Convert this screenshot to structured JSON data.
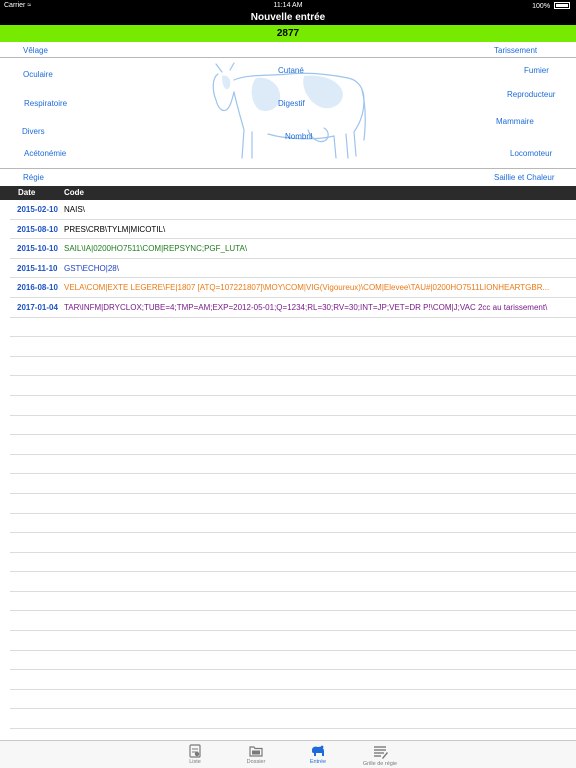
{
  "status_bar": {
    "carrier": "Carrier",
    "wifi_icon": "wifi-icon",
    "time": "11:14 AM",
    "battery": "100%"
  },
  "nav": {
    "title": "Nouvelle entrée"
  },
  "animal": {
    "number": "2877",
    "highlight_color": "#76ea00"
  },
  "categories": {
    "velage": "Vêlage",
    "tarissement": "Tarissement",
    "oculaire": "Oculaire",
    "cutane": "Cutané",
    "fumier": "Fumier",
    "reproducteur": "Reproducteur",
    "respiratoire": "Respiratoire",
    "digestif": "Digestif",
    "mammaire": "Mammaire",
    "divers": "Divers",
    "nombril": "Nombril",
    "acetonemie": "Acétonémie",
    "locomoteur": "Locomoteur",
    "regie": "Régie",
    "saillie": "Saillie et Chaleur"
  },
  "table": {
    "headers": {
      "date": "Date",
      "code": "Code"
    },
    "rows": [
      {
        "date": "2015-02-10",
        "code": "NAIS\\",
        "color": "#000000"
      },
      {
        "date": "2015-08-10",
        "code": "PRES\\CRB\\TYLM|MICOTIL\\",
        "color": "#000000"
      },
      {
        "date": "2015-10-10",
        "code": "SAIL\\IA|0200HO7511\\COM|REPSYNC;PGF_LUTA\\",
        "color": "#1e7a1e"
      },
      {
        "date": "2015-11-10",
        "code": "GST\\ECHO|28\\",
        "color": "#1d3fc4"
      },
      {
        "date": "2016-08-10",
        "code": "VELA\\COM|EXTE LEGERE\\FE|1807 [ATQ=107221807]\\MOY\\COM|VIG(Vigoureux)\\COM|Elevee\\TAU#|0200HO7511LIONHEARTGBR...",
        "color": "#ea7a16"
      },
      {
        "date": "2017-01-04",
        "code": "TAR\\INFM|DRYCLOX;TUBE=4;TMP=AM;EXP=2012-05-01;Q=1234;RL=30;RV=30;INT=JP;VET=DR P!\\COM|J;VAC 2cc au tarissement\\",
        "color": "#7a1a8a"
      }
    ]
  },
  "tabs": [
    {
      "label": "Liste",
      "icon": "list-doc-icon"
    },
    {
      "label": "Dossier",
      "icon": "folder-icon"
    },
    {
      "label": "Entrée",
      "icon": "cow-entry-icon"
    },
    {
      "label": "Grille de régie",
      "icon": "grid-edit-icon"
    }
  ],
  "accent_color": "#1d6bd8"
}
